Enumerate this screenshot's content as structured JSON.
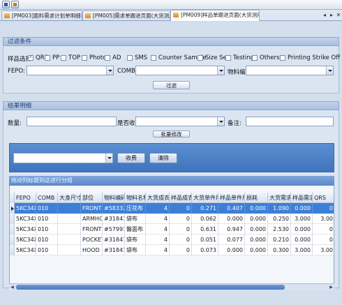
{
  "tabs": [
    {
      "label": "[PM003]面料需求计划单明细表",
      "active": false
    },
    {
      "label": "[PM005]需求单跟进页面(大货测用户",
      "active": false
    },
    {
      "label": "[PM009]样品单跟进页面(大货测用户",
      "active": true
    }
  ],
  "tab_controls": {
    "prev": "◂",
    "next": "▸",
    "close": "✕"
  },
  "filter": {
    "section_title": "过滤条件",
    "sample_label": "样品选择:",
    "checkboxes": [
      {
        "label": "QRS",
        "checked": true
      },
      {
        "label": "PP",
        "checked": false
      },
      {
        "label": "TOP",
        "checked": false
      },
      {
        "label": "Photo",
        "checked": false
      },
      {
        "label": "AD",
        "checked": false
      },
      {
        "label": "SMS",
        "checked": false
      },
      {
        "label": "Counter Sample",
        "checked": false
      },
      {
        "label": "Size Set",
        "checked": false
      },
      {
        "label": "Testing",
        "checked": false
      },
      {
        "label": "Others",
        "checked": false
      },
      {
        "label": "Printing Strike Off",
        "checked": false
      }
    ],
    "fepo_label": "FEPO:",
    "comb_label": "COMB:",
    "material_label": "物料编号:",
    "filter_button": "过滤"
  },
  "results": {
    "section_title": "结果明细",
    "qty_label": "数量:",
    "received_label": "是否收费:",
    "remark_label": "备注:",
    "batch_button": "批量修改"
  },
  "search": {
    "receive_button": "收费",
    "clear_button": "清除"
  },
  "grid": {
    "drag_hint": "拖动列标题到这进行分组",
    "columns": [
      "FEPO",
      "COMB",
      "大身尺寸",
      "部位",
      "物料编码",
      "物料名称",
      "大货成衣...",
      "样品成衣...",
      "大货单件用...",
      "样品单件用量",
      "损耗",
      "大货需求...",
      "样品需求...",
      "QRS"
    ],
    "rows": [
      [
        "5KC34X5...",
        "010",
        "",
        "FRONT&...",
        "#583323",
        "压花布",
        "4",
        "0",
        "0.271",
        "0.407",
        "0.000",
        "1.090",
        "0.000",
        "0"
      ],
      [
        "5KC34X5...",
        "010",
        "",
        "ARMHOL...",
        "#318411",
        "袋布",
        "4",
        "0",
        "0.062",
        "0.000",
        "0.000",
        "0.250",
        "3.000",
        "3.00"
      ],
      [
        "5KC34X5...",
        "010",
        "",
        "FRONT /...",
        "#579910",
        "醫面布",
        "4",
        "0",
        "0.631",
        "0.947",
        "0.000",
        "2.530",
        "0.000",
        "0"
      ],
      [
        "5KC34X5...",
        "010",
        "",
        "POCKET ...",
        "#318411",
        "袋布",
        "4",
        "0",
        "0.051",
        "0.077",
        "0.000",
        "0.210",
        "0.000",
        "0"
      ],
      [
        "5KC34X5...",
        "010",
        "",
        "HOOD S...",
        "#318411",
        "袋布",
        "4",
        "0",
        "0.073",
        "0.000",
        "0.000",
        "0.300",
        "3.000",
        "3.00"
      ]
    ]
  },
  "colors": {
    "selected_row": "#3d7fd6",
    "band": "#4a7cc5",
    "header": "#a9bfde"
  }
}
